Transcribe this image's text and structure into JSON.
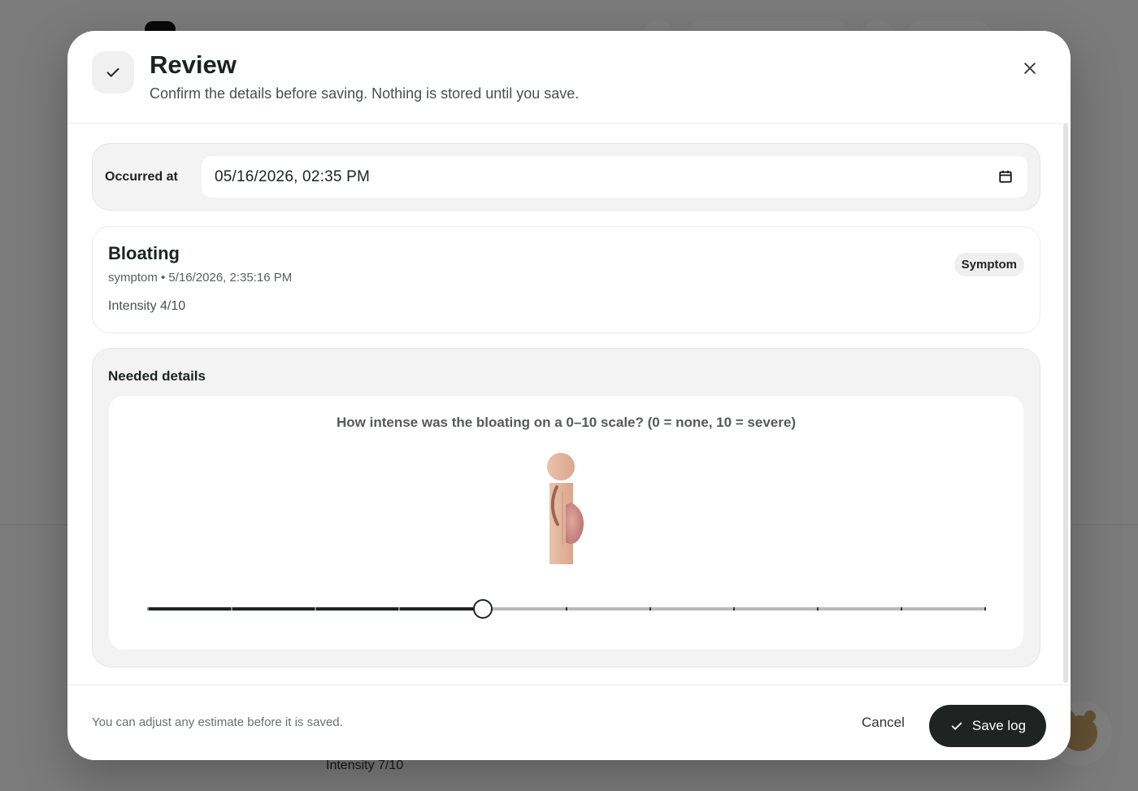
{
  "background": {
    "intensity_text": "Intensity 7/10"
  },
  "modal": {
    "title": "Review",
    "subtitle": "Confirm the details before saving. Nothing is stored until you save.",
    "header_icon": "check-icon",
    "close_icon": "close-icon"
  },
  "occurred": {
    "label": "Occurred at",
    "value": "05/16/2026, 02:35 PM",
    "icon": "calendar-icon"
  },
  "entry": {
    "title": "Bloating",
    "meta": "symptom • 5/16/2026, 2:35:16 PM",
    "intensity": "Intensity 4/10",
    "badge": "Symptom"
  },
  "needed": {
    "title": "Needed details",
    "question": "How intense was the bloating on a 0–10 scale? (0 = none, 10 = severe)",
    "slider": {
      "min": 0,
      "max": 10,
      "value": 4
    }
  },
  "footer": {
    "note": "You can adjust any estimate before it is saved.",
    "cancel_label": "Cancel",
    "save_label": "Save log"
  },
  "colors": {
    "primary": "#1f2322",
    "overlay": "rgba(0,0,0,0.5)",
    "figure_skin": "#e8b9a3",
    "figure_belly": "#c47f7f"
  }
}
